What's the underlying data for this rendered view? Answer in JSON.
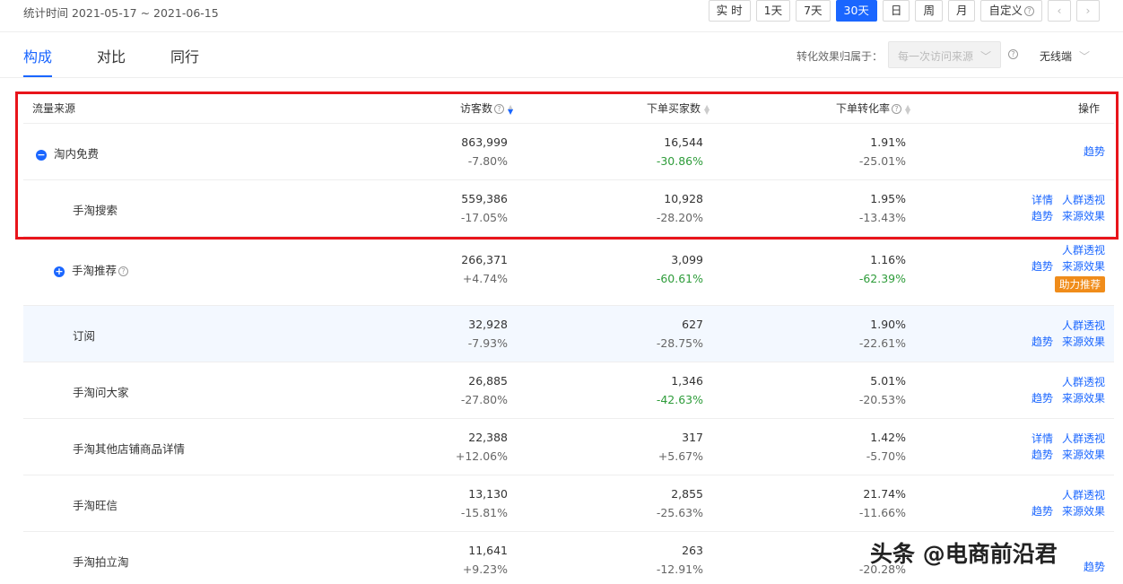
{
  "header": {
    "stat_time": "统计时间 2021-05-17 ~ 2021-06-15",
    "ranges": [
      "实 时",
      "1天",
      "7天",
      "30天",
      "日",
      "周",
      "月",
      "自定义"
    ],
    "active_range": "30天",
    "prev": "‹",
    "next": "›"
  },
  "tabs": [
    "构成",
    "对比",
    "同行"
  ],
  "active_tab": "构成",
  "attribution": {
    "label": "转化效果归属于：",
    "select_value": "每一次访问来源",
    "device": "无线端"
  },
  "table": {
    "columns": {
      "source": "流量来源",
      "visitors": "访客数",
      "buyers": "下单买家数",
      "rate": "下单转化率",
      "ops": "操作"
    },
    "rows": [
      {
        "source": "淘内免费",
        "visitors": "863,999",
        "visitors_change": "-7.80%",
        "buyers": "16,544",
        "buyers_change": "-30.86%",
        "rate": "1.91%",
        "rate_change": "-25.01%",
        "ops": [
          "趋势"
        ]
      },
      {
        "source": "手淘搜索",
        "visitors": "559,386",
        "visitors_change": "-17.05%",
        "buyers": "10,928",
        "buyers_change": "-28.20%",
        "rate": "1.95%",
        "rate_change": "-13.43%",
        "ops": [
          "详情",
          "人群透视",
          "趋势",
          "来源效果"
        ]
      },
      {
        "source": "手淘推荐",
        "visitors": "266,371",
        "visitors_change": "+4.74%",
        "buyers": "3,099",
        "buyers_change": "-60.61%",
        "rate": "1.16%",
        "rate_change": "-62.39%",
        "ops": [
          "人群透视",
          "趋势",
          "来源效果"
        ],
        "badge": "助力推荐"
      },
      {
        "source": "订阅",
        "visitors": "32,928",
        "visitors_change": "-7.93%",
        "buyers": "627",
        "buyers_change": "-28.75%",
        "rate": "1.90%",
        "rate_change": "-22.61%",
        "ops": [
          "人群透视",
          "趋势",
          "来源效果"
        ]
      },
      {
        "source": "手淘问大家",
        "visitors": "26,885",
        "visitors_change": "-27.80%",
        "buyers": "1,346",
        "buyers_change": "-42.63%",
        "rate": "5.01%",
        "rate_change": "-20.53%",
        "ops": [
          "人群透视",
          "趋势",
          "来源效果"
        ]
      },
      {
        "source": "手淘其他店铺商品详情",
        "visitors": "22,388",
        "visitors_change": "+12.06%",
        "buyers": "317",
        "buyers_change": "+5.67%",
        "rate": "1.42%",
        "rate_change": "-5.70%",
        "ops": [
          "详情",
          "人群透视",
          "趋势",
          "来源效果"
        ]
      },
      {
        "source": "手淘旺信",
        "visitors": "13,130",
        "visitors_change": "-15.81%",
        "buyers": "2,855",
        "buyers_change": "-25.63%",
        "rate": "21.74%",
        "rate_change": "-11.66%",
        "ops": [
          "人群透视",
          "趋势",
          "来源效果"
        ]
      },
      {
        "source": "手淘拍立淘",
        "visitors": "11,641",
        "visitors_change": "+9.23%",
        "buyers": "263",
        "buyers_change": "-12.91%",
        "rate": "",
        "rate_change": "-20.28%",
        "ops": [
          "趋势"
        ]
      }
    ]
  },
  "watermark": "头条 @电商前沿君",
  "colors": {
    "accent": "#1a66ff",
    "highlight_border": "#e8141b",
    "positive_green": "#2e9c3a",
    "badge": "#f08c1a"
  }
}
